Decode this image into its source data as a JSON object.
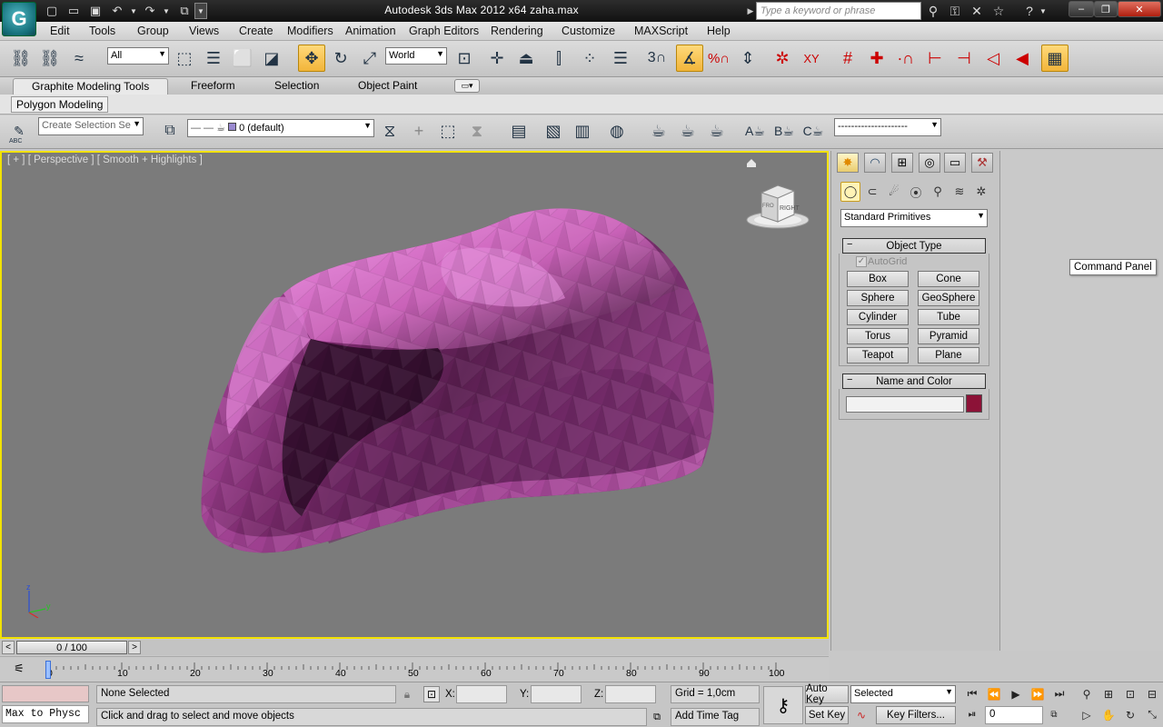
{
  "titlebar": {
    "app_logo": "G",
    "title": "Autodesk 3ds Max  2012 x64      zaha.max",
    "search_placeholder": "Type a keyword or phrase"
  },
  "menu": [
    "Edit",
    "Tools",
    "Group",
    "Views",
    "Create",
    "Modifiers",
    "Animation",
    "Graph Editors",
    "Rendering",
    "Customize",
    "MAXScript",
    "Help"
  ],
  "toolbar": {
    "selection_filter": "All",
    "reference_coord": "World",
    "snap_count": "3",
    "angle_snap_label": "XY"
  },
  "ribbon": {
    "tabs": [
      "Graphite Modeling Tools",
      "Freeform",
      "Selection",
      "Object Paint"
    ],
    "panel_label": "Polygon Modeling"
  },
  "second_toolbar": {
    "named_selection_placeholder": "Create Selection Se",
    "layer": "0 (default)",
    "abc": "ABC",
    "set_a": "A",
    "set_b": "B",
    "set_c": "C"
  },
  "viewport": {
    "label": "[ + ] [ Perspective ] [ Smooth + Highlights ]",
    "viewcube_face": "RIGHT",
    "viewcube_side": "FRO",
    "axis_z": "z",
    "axis_y": "y",
    "object_color": "#b03c9a"
  },
  "command_panel": {
    "category": "Standard Primitives",
    "object_type_title": "Object Type",
    "autogrid_label": "AutoGrid",
    "autogrid_checked": true,
    "primitives": [
      "Box",
      "Cone",
      "Sphere",
      "GeoSphere",
      "Cylinder",
      "Tube",
      "Torus",
      "Pyramid",
      "Teapot",
      "Plane"
    ],
    "name_color_title": "Name and Color",
    "name_value": "",
    "color": "#8c1237",
    "tooltip": "Command Panel"
  },
  "time_slider": {
    "frame_display": "0 / 100",
    "ticks": [
      "0",
      "10",
      "20",
      "30",
      "40",
      "50",
      "60",
      "70",
      "80",
      "90",
      "100"
    ]
  },
  "status": {
    "maxscript_text": "Max to Physc",
    "selection_info": "None Selected",
    "prompt": "Click and drag to select and move objects",
    "x_label": "X:",
    "y_label": "Y:",
    "z_label": "Z:",
    "x_value": "",
    "y_value": "",
    "z_value": "",
    "grid": "Grid = 1,0cm",
    "add_time_tag": "Add Time Tag",
    "auto_key": "Auto Key",
    "set_key": "Set Key",
    "key_mode": "Selected",
    "key_filters": "Key Filters...",
    "current_frame": "0"
  }
}
